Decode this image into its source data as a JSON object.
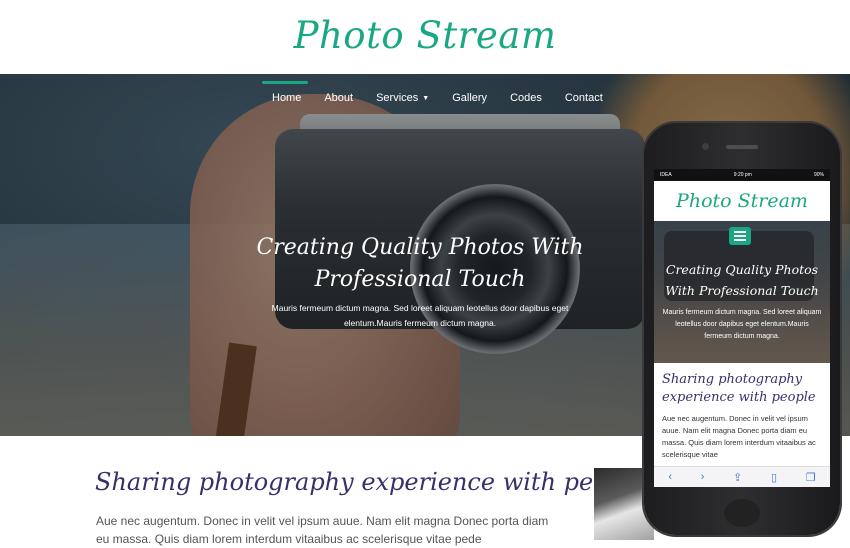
{
  "brand": {
    "logo": "Photo Stream",
    "accent": "#1aa884",
    "heading_color": "#3a2f6b"
  },
  "nav": {
    "items": [
      "Home",
      "About",
      "Services",
      "Gallery",
      "Codes",
      "Contact"
    ]
  },
  "hero": {
    "title": "Creating Quality Photos With Professional Touch",
    "text": "Mauris fermeum dictum magna. Sed loreet aliquam leotellus door dapibus eget elentum.Mauris fermeum dictum magna."
  },
  "section": {
    "title": "Sharing photography experience with people",
    "text": "Aue nec augentum. Donec in velit vel ipsum auue. Nam elit magna Donec porta diam eu massa. Quis diam lorem interdum vitaaibus ac scelerisque vitae pede"
  },
  "mobile": {
    "status_carrier": "IDEA",
    "status_time": "9:20 pm",
    "status_battery": "90%",
    "logo": "Photo Stream",
    "hero_title": "Creating Quality Photos With Professional Touch",
    "hero_text": "Mauris fermeum dictum magna. Sed loreet aliquam leotellus door dapibus eget elentum.Mauris fermeum dictum magna.",
    "section_title": "Sharing photography experience with people",
    "section_text": "Aue nec augentum. Donec in velit vel ipsum auue. Nam elit magna Donec porta diam eu massa. Quis diam lorem interdum vitaaibus ac scelerisque vitae",
    "toolbar_icons": [
      "back-icon",
      "forward-icon",
      "share-icon",
      "bookmarks-icon",
      "tabs-icon"
    ]
  }
}
